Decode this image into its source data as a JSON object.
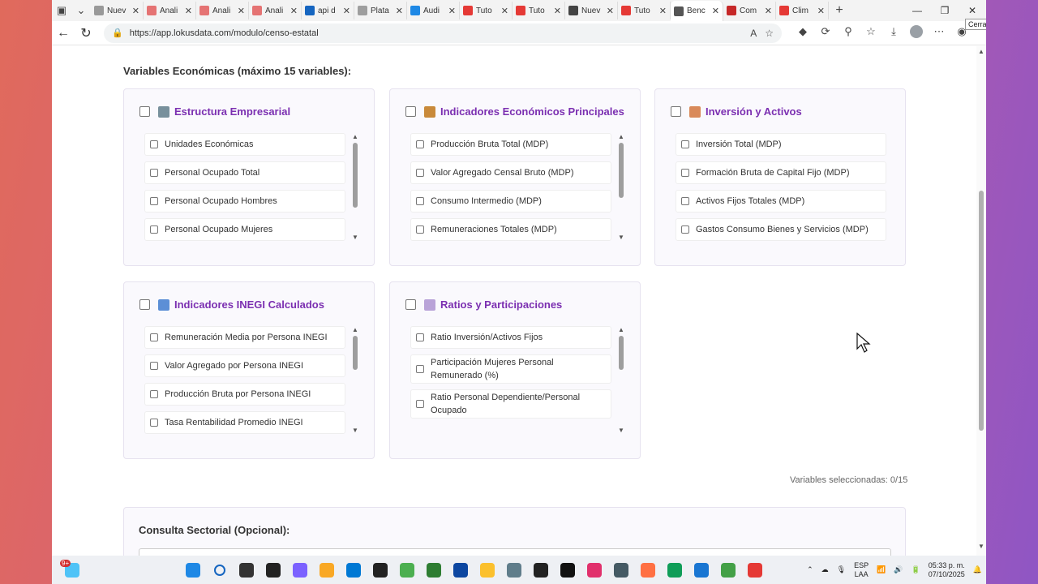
{
  "browser": {
    "tabs": [
      {
        "label": "Nuev",
        "color": "#999999"
      },
      {
        "label": "Anali",
        "color": "#e57373"
      },
      {
        "label": "Anali",
        "color": "#e57373"
      },
      {
        "label": "Anali",
        "color": "#e57373"
      },
      {
        "label": "api d",
        "color": "#1565c0"
      },
      {
        "label": "Plata",
        "color": "#9e9e9e"
      },
      {
        "label": "Audi",
        "color": "#1e88e5"
      },
      {
        "label": "Tuto",
        "color": "#e53935"
      },
      {
        "label": "Tuto",
        "color": "#e53935"
      },
      {
        "label": "Nuev",
        "color": "#444444"
      },
      {
        "label": "Tuto",
        "color": "#e53935"
      },
      {
        "label": "Benc",
        "color": "#555555"
      },
      {
        "label": "Com",
        "color": "#c62828"
      },
      {
        "label": "Clim",
        "color": "#e53935"
      }
    ],
    "tooltip": "Cerrar",
    "url": "https://app.lokusdata.com/modulo/censo-estatal"
  },
  "page": {
    "section_title": "Variables Económicas (máximo 15 variables):",
    "cards": [
      {
        "title": "Estructura Empresarial",
        "emoji_color": "#78909c",
        "items": [
          "Unidades Económicas",
          "Personal Ocupado Total",
          "Personal Ocupado Hombres",
          "Personal Ocupado Mujeres"
        ]
      },
      {
        "title": "Indicadores Económicos Principales",
        "emoji_color": "#c98a3a",
        "items": [
          "Producción Bruta Total (MDP)",
          "Valor Agregado Censal Bruto (MDP)",
          "Consumo Intermedio (MDP)",
          "Remuneraciones Totales (MDP)"
        ]
      },
      {
        "title": "Inversión y Activos",
        "emoji_color": "#d98a5a",
        "items": [
          "Inversión Total (MDP)",
          "Formación Bruta de Capital Fijo (MDP)",
          "Activos Fijos Totales (MDP)",
          "Gastos Consumo Bienes y Servicios (MDP)"
        ]
      },
      {
        "title": "Indicadores INEGI Calculados",
        "emoji_color": "#5c8fd6",
        "items": [
          "Remuneración Media por Persona INEGI",
          "Valor Agregado por Persona INEGI",
          "Producción Bruta por Persona INEGI",
          "Tasa Rentabilidad Promedio INEGI"
        ]
      },
      {
        "title": "Ratios y Participaciones",
        "emoji_color": "#b9a3d8",
        "items": [
          "Ratio Inversión/Activos Fijos",
          "Participación Mujeres Personal Remunerado (%)",
          "Ratio Personal Dependiente/Personal Ocupado"
        ]
      }
    ],
    "selected_count": "Variables seleccionadas: 0/15",
    "consulta_title": "Consulta Sectorial (Opcional):"
  },
  "taskbar": {
    "badge": "9+",
    "apps": [
      "#1e88e5",
      "#1565c0",
      "#333333",
      "#222222",
      "#7b61ff",
      "#f9a825",
      "#0078d4",
      "#222222",
      "#4caf50",
      "#2e7d32",
      "#0d47a1",
      "#fbc02d",
      "#607d8b",
      "#222222",
      "#111111",
      "#e1306c",
      "#455a64",
      "#ff7043",
      "#0f9d58",
      "#1976d2",
      "#43a047",
      "#e53935"
    ],
    "lang_top": "ESP",
    "lang_bottom": "LAA",
    "time": "05:33 p. m.",
    "date": "07/10/2025"
  }
}
